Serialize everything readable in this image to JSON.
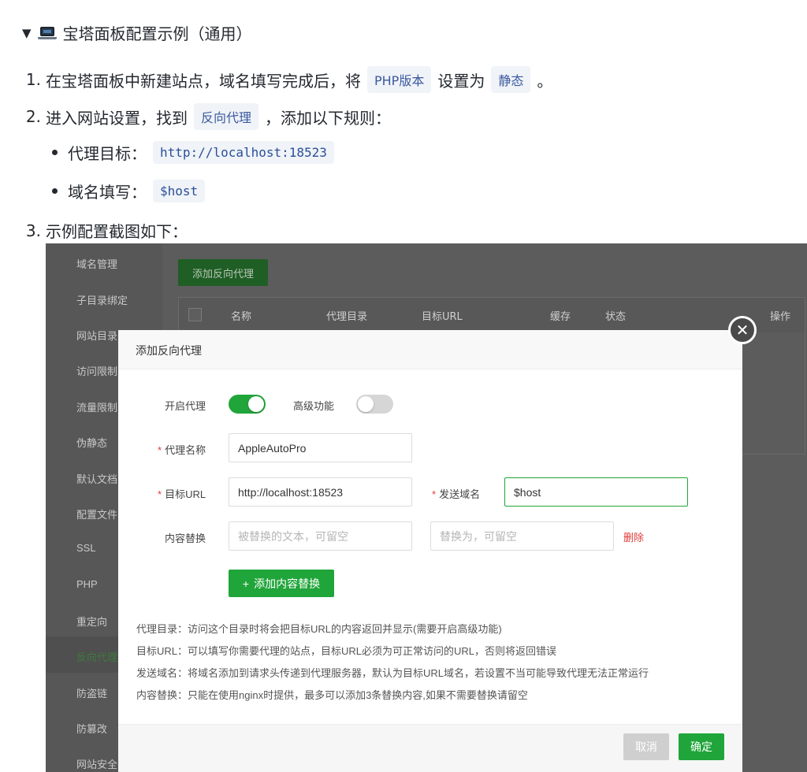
{
  "summary": {
    "label": "宝塔面板配置示例（通用）",
    "icon": "laptop-icon"
  },
  "steps": [
    {
      "num": "1.",
      "pre": "在宝塔面板中新建站点，域名填写完成后，将",
      "code1": "PHP版本",
      "mid": "设置为",
      "code2": "静态",
      "post": "。"
    },
    {
      "num": "2.",
      "pre": "进入网站设置，找到",
      "code1": "反向代理",
      "post": "，添加以下规则："
    },
    {
      "num": "3.",
      "pre": "示例配置截图如下："
    }
  ],
  "bullets": [
    {
      "label": "代理目标：",
      "code": "http://localhost:18523"
    },
    {
      "label": "域名填写：",
      "code": "$host"
    }
  ],
  "screenshot": {
    "sidebar": [
      "域名管理",
      "子目录绑定",
      "网站目录",
      "访问限制",
      "流量限制",
      "伪静态",
      "默认文档",
      "配置文件",
      "SSL",
      "PHP",
      "重定向",
      "反向代理",
      "防盗链",
      "防篡改",
      "网站安全"
    ],
    "active_item": "反向代理",
    "add_button": "添加反向代理",
    "table_headers": [
      "名称",
      "代理目录",
      "目标URL",
      "缓存",
      "状态",
      "操作"
    ],
    "dialog": {
      "title": "添加反向代理",
      "enable_proxy_label": "开启代理",
      "enable_proxy_on": true,
      "advanced_label": "高级功能",
      "advanced_on": false,
      "proxy_name_label": "代理名称",
      "proxy_name_value": "AppleAutoPro",
      "target_url_label": "目标URL",
      "target_url_value": "http://localhost:18523",
      "send_domain_label": "发送域名",
      "send_domain_value": "$host",
      "content_replace_label": "内容替换",
      "replace_from_placeholder": "被替换的文本，可留空",
      "replace_to_placeholder": "替换为，可留空",
      "delete_label": "删除",
      "add_content_button": "添加内容替换",
      "notes": [
        "代理目录：访问这个目录时将会把目标URL的内容返回并显示(需要开启高级功能)",
        "目标URL：可以填写你需要代理的站点，目标URL必须为可正常访问的URL，否则将返回错误",
        "发送域名：将域名添加到请求头传递到代理服务器，默认为目标URL域名，若设置不当可能导致代理无法正常运行",
        "内容替换：只能在使用nginx时提供，最多可以添加3条替换内容,如果不需要替换请留空"
      ],
      "cancel_button": "取消",
      "confirm_button": "确定"
    }
  },
  "colors": {
    "accent_green": "#20a53a",
    "required_red": "#e23b3b",
    "code_blue": "#2a4f9a"
  }
}
